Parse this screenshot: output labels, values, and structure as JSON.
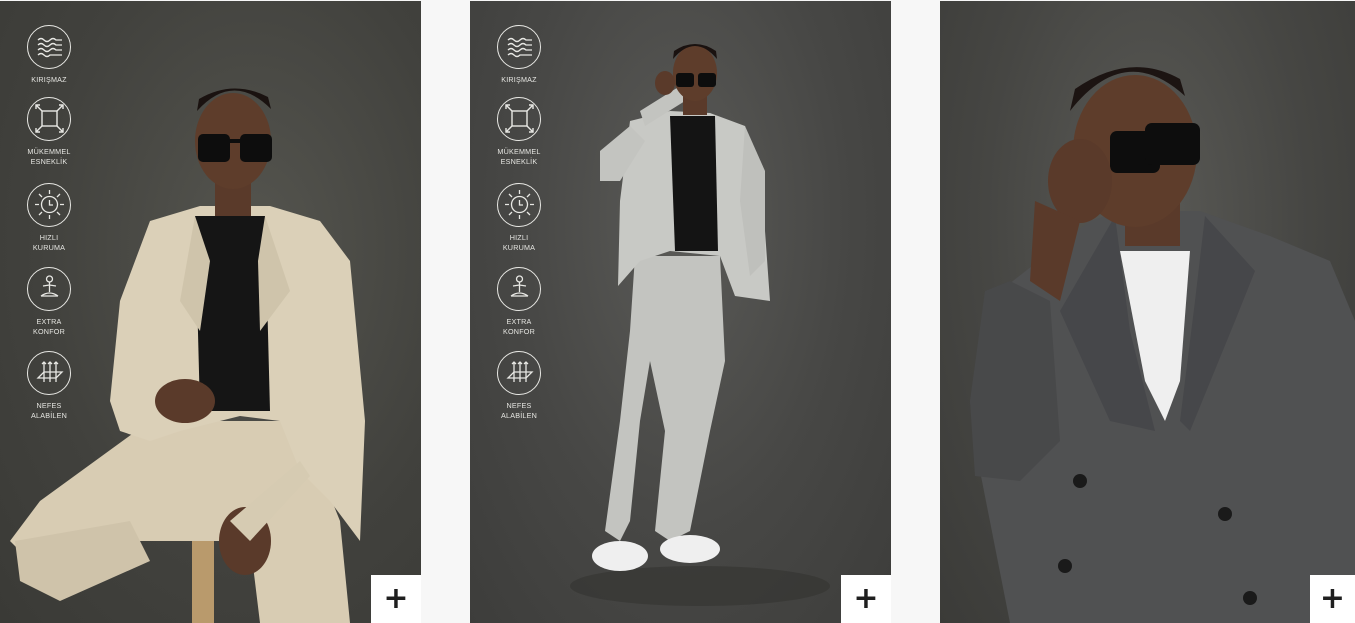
{
  "products": [
    {
      "features": [
        {
          "label": "KIRIŞMAZ",
          "icon": "wrinkle-free-icon"
        },
        {
          "label": "MÜKEMMEL\nESNEKLİK",
          "icon": "stretch-icon"
        },
        {
          "label": "HIZLI\nKURUMA",
          "icon": "quick-dry-icon"
        },
        {
          "label": "EXTRA\nKONFOR",
          "icon": "comfort-icon"
        },
        {
          "label": "NEFES\nALABİLEN",
          "icon": "breathable-icon"
        }
      ],
      "suit_color": "#d9cfb8",
      "add_label": "+"
    },
    {
      "features": [
        {
          "label": "KIRIŞMAZ",
          "icon": "wrinkle-free-icon"
        },
        {
          "label": "MÜKEMMEL\nESNEKLİK",
          "icon": "stretch-icon"
        },
        {
          "label": "HIZLI\nKURUMA",
          "icon": "quick-dry-icon"
        },
        {
          "label": "EXTRA\nKONFOR",
          "icon": "comfort-icon"
        },
        {
          "label": "NEFES\nALABİLEN",
          "icon": "breathable-icon"
        }
      ],
      "suit_color": "#c5c6c2",
      "add_label": "+"
    },
    {
      "features": [],
      "suit_color": "#4e4f50",
      "add_label": "+"
    }
  ]
}
